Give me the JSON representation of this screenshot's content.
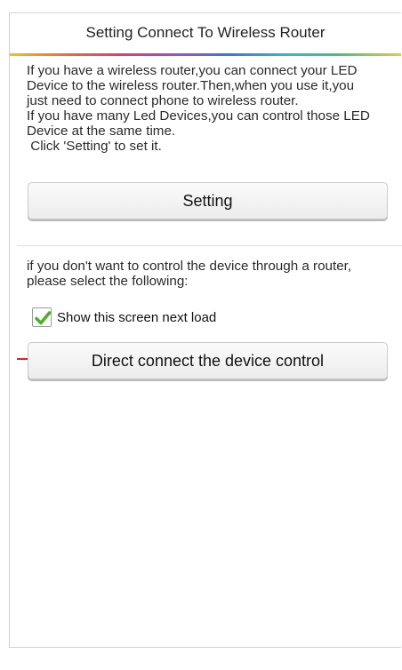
{
  "header": {
    "title": "Setting Connect To Wireless Router"
  },
  "description": {
    "lines": [
      "If you have a wireless router,you can connect your LED",
      "Device to the wireless router.Then,when you use it,you",
      "just need to connect phone to wireless router.",
      "If you have many Led Devices,you can control those LED",
      "Device at the same time.",
      " Click 'Setting' to set it."
    ]
  },
  "setting_button": {
    "label": "Setting"
  },
  "direct_note": {
    "lines": [
      "if you don't want to control the device through a router,",
      "please select the following:"
    ]
  },
  "show_screen_checkbox": {
    "label": "Show this screen next load",
    "checked": true
  },
  "direct_button": {
    "label": "Direct connect the device control"
  },
  "colors": {
    "check_green": "#4caf2a",
    "arrow_red": "#e4202a"
  },
  "icons": {
    "check": "checkmark-icon",
    "arrow": "red-arrow-icon"
  }
}
